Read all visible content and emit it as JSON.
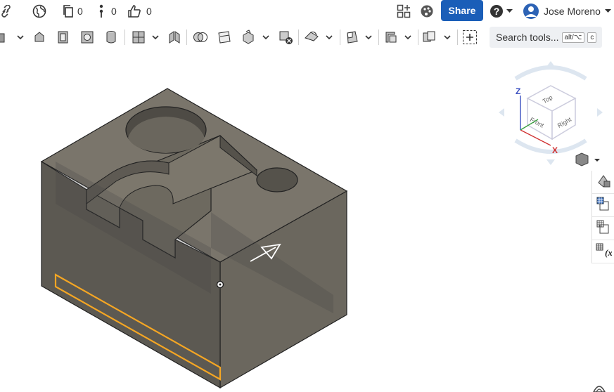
{
  "topbar": {
    "docs_count": "0",
    "branches_count": "0",
    "likes_count": "0",
    "share_label": "Share",
    "user_name": "Jose Moreno"
  },
  "toolbar": {
    "search_label": "Search tools...",
    "search_shortcut_1": "alt/⌥",
    "search_shortcut_2": "c"
  },
  "viewcube": {
    "axis_z": "Z",
    "axis_x": "X",
    "face_top": "Top",
    "face_front": "Front",
    "face_right": "Right"
  },
  "colors": {
    "accent": "#1a5eb8",
    "selection": "#f5a623",
    "part_top": "#7a756b",
    "part_front": "#5c5952",
    "part_right": "#6b675e"
  }
}
